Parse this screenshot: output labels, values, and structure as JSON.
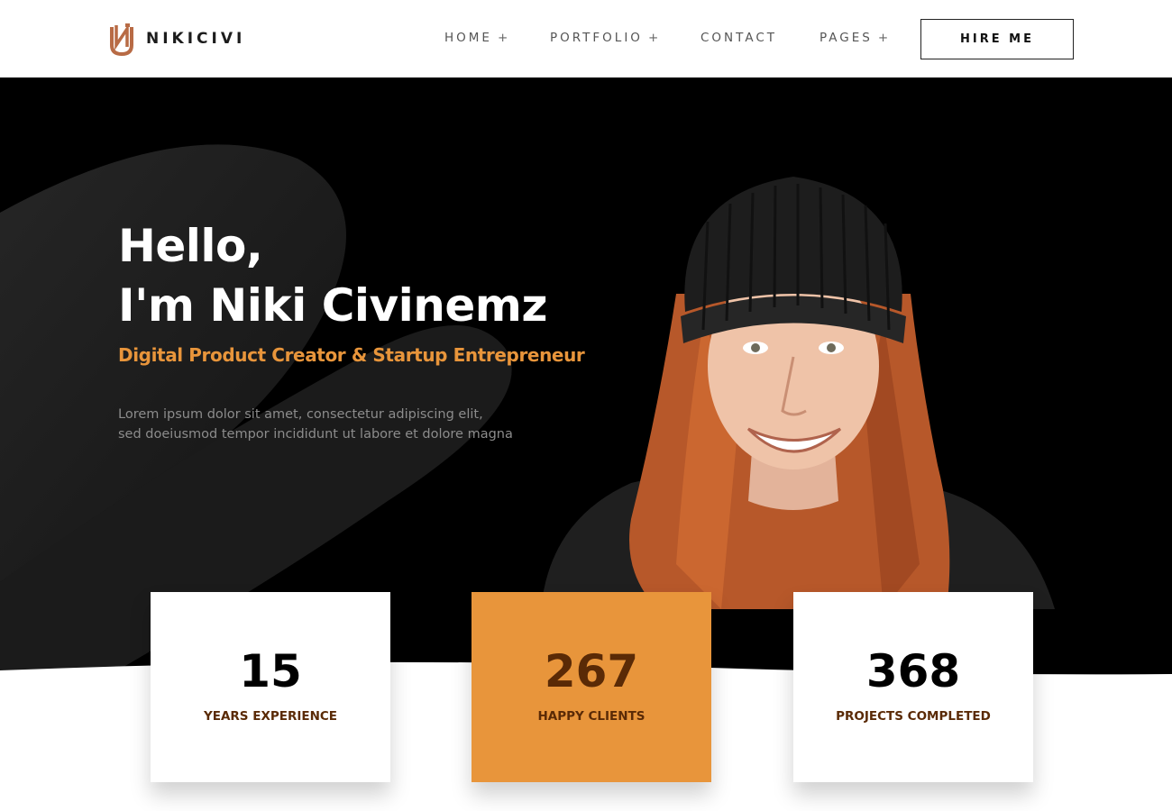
{
  "brand": {
    "name": "NIKICIVI",
    "accent_color": "#e8953b",
    "logo_color": "#b86b45"
  },
  "nav": {
    "items": [
      {
        "label": "HOME",
        "has_submenu": true,
        "toggle": "+"
      },
      {
        "label": "PORTFOLIO",
        "has_submenu": true,
        "toggle": "+"
      },
      {
        "label": "CONTACT",
        "has_submenu": false
      },
      {
        "label": "PAGES",
        "has_submenu": true,
        "toggle": "+"
      }
    ],
    "cta_label": "HIRE ME"
  },
  "hero": {
    "greeting": "Hello,",
    "name_line": "I'm Niki Civinemz",
    "subtitle": "Digital Product Creator & Startup Entrepreneur",
    "description_lines": [
      "Lorem ipsum dolor sit amet, consectetur adipiscing elit,",
      "sed doeiusmod tempor incididunt ut labore et dolore magna"
    ],
    "background_color": "#000000"
  },
  "stats": [
    {
      "value": "15",
      "label": "YEARS EXPERIENCE",
      "highlighted": false
    },
    {
      "value": "267",
      "label": "HAPPY CLIENTS",
      "highlighted": true
    },
    {
      "value": "368",
      "label": "PROJECTS COMPLETED",
      "highlighted": false
    }
  ]
}
